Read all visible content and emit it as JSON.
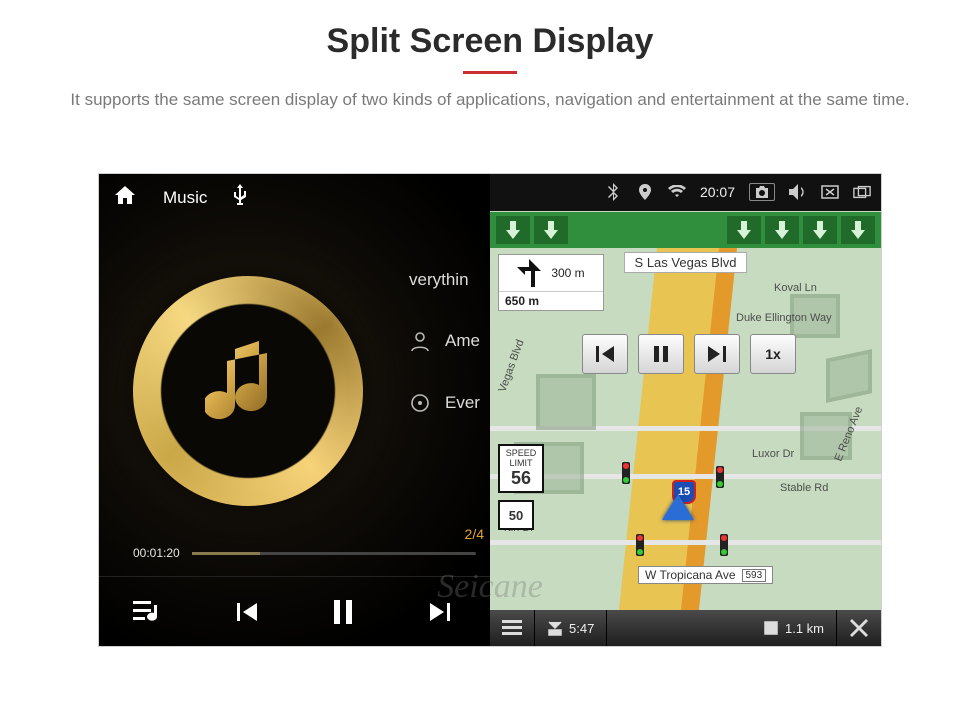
{
  "header": {
    "title": "Split Screen Display",
    "description": "It supports the same screen display of two kinds of applications, navigation and entertainment at the same time."
  },
  "system_status": {
    "time": "20:07",
    "icons": [
      "bluetooth",
      "location",
      "wifi"
    ],
    "tray_icons": [
      "camera",
      "volume",
      "close-window",
      "split-screen"
    ]
  },
  "music": {
    "top_label": "Music",
    "title_partial": "verythin",
    "artist_partial": "Ame",
    "album_partial": "Ever",
    "track_index": "2/4",
    "elapsed": "00:01:20",
    "controls": [
      "queue",
      "previous",
      "pause",
      "next"
    ]
  },
  "navigation": {
    "top_street": "S Las Vegas Blvd",
    "turn": {
      "dist_small": "300 m",
      "dist_main": "650 m"
    },
    "sim_controls": {
      "prev": "prev",
      "pause": "pause",
      "next": "next",
      "speed": "1x"
    },
    "map_labels": {
      "koval": "Koval Ln",
      "duke": "Duke Ellington Way",
      "vegas_blvd": "Vegas Blvd",
      "luxor": "Luxor Dr",
      "stable": "Stable Rd",
      "reno": "E Reno Ave",
      "rtin": "rtin Dr"
    },
    "speed_limit": {
      "label": "SPEED LIMIT",
      "value": "56"
    },
    "route_shield": "50",
    "interstate": "15",
    "tropicana": {
      "name": "W Tropicana Ave",
      "badge": "593"
    },
    "bottom": {
      "eta": "5:47",
      "remaining": "1.1 km"
    },
    "chevrons": 6
  },
  "watermark": "Seicane"
}
